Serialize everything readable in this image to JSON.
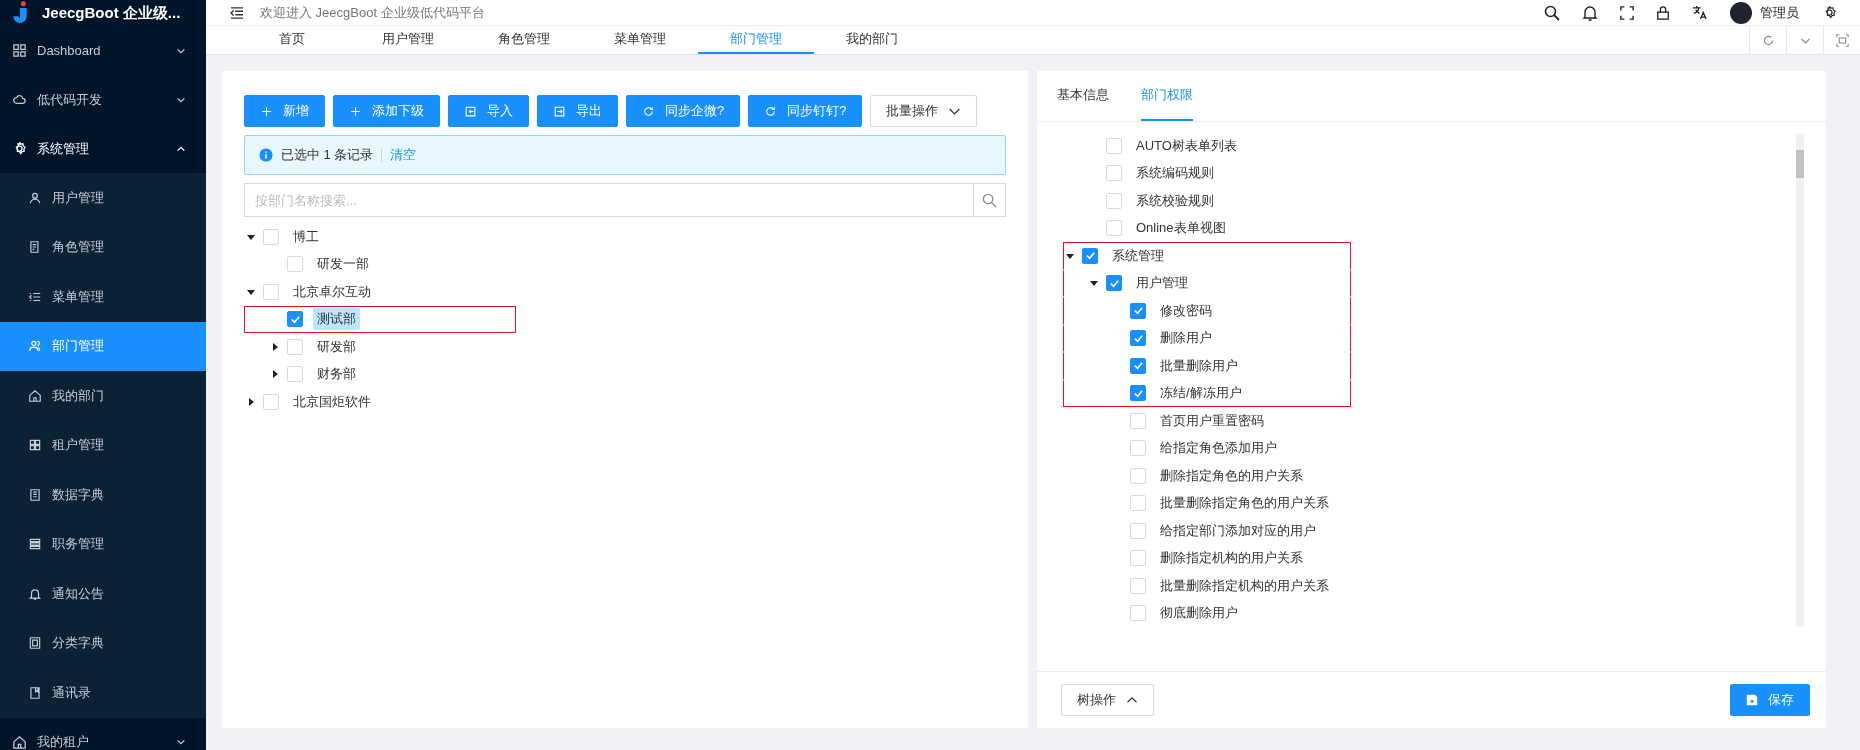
{
  "sidebar": {
    "logo_text": "JeecgBoot 企业级...",
    "items": [
      {
        "kind": "dashboard",
        "label": "Dashboard",
        "selected": false,
        "expanded": false
      },
      {
        "kind": "cloud",
        "label": "低代码开发",
        "selected": false,
        "expanded": false
      },
      {
        "kind": "gear",
        "label": "系统管理",
        "selected": false,
        "expanded": true,
        "children": [
          {
            "kind": "user",
            "label": "用户管理",
            "selected": false
          },
          {
            "kind": "role",
            "label": "角色管理",
            "selected": false
          },
          {
            "kind": "menu",
            "label": "菜单管理",
            "selected": false
          },
          {
            "kind": "team",
            "label": "部门管理",
            "selected": true
          },
          {
            "kind": "home",
            "label": "我的部门",
            "selected": false
          },
          {
            "kind": "grid",
            "label": "租户管理",
            "selected": false
          },
          {
            "kind": "book",
            "label": "数据字典",
            "selected": false
          },
          {
            "kind": "stack",
            "label": "职务管理",
            "selected": false
          },
          {
            "kind": "bell",
            "label": "通知公告",
            "selected": false
          },
          {
            "kind": "frame",
            "label": "分类字典",
            "selected": false
          },
          {
            "kind": "note",
            "label": "通讯录",
            "selected": false
          }
        ]
      },
      {
        "kind": "home",
        "label": "我的租户",
        "selected": false,
        "expanded": false
      }
    ]
  },
  "header": {
    "welcome": "欢迎进入 JeecgBoot 企业级低代码平台",
    "user_name": "管理员"
  },
  "tabs": [
    {
      "label": "首页",
      "selected": false
    },
    {
      "label": "用户管理",
      "selected": false
    },
    {
      "label": "角色管理",
      "selected": false
    },
    {
      "label": "菜单管理",
      "selected": false
    },
    {
      "label": "部门管理",
      "selected": true
    },
    {
      "label": "我的部门",
      "selected": false
    }
  ],
  "toolbar": [
    {
      "kind": "add",
      "label": "新增"
    },
    {
      "kind": "add",
      "label": "添加下级"
    },
    {
      "kind": "import",
      "label": "导入"
    },
    {
      "kind": "export",
      "label": "导出"
    },
    {
      "kind": "sync",
      "label": "同步企微?"
    },
    {
      "kind": "sync",
      "label": "同步钉钉?"
    },
    {
      "kind": "menu",
      "label": "批量操作"
    }
  ],
  "selection_alert": {
    "message": "已选中 1 条记录",
    "clear_link": "清空"
  },
  "dept_search": {
    "placeholder": "按部门名称搜索..."
  },
  "dept_tree": [
    {
      "kind": "branch",
      "label": "博工",
      "expanded": true,
      "checked": false,
      "selected": false,
      "highlighted": false,
      "children": [
        {
          "kind": "leaf",
          "label": "研发一部",
          "checked": false,
          "selected": false,
          "highlighted": false
        }
      ]
    },
    {
      "kind": "branch",
      "label": "北京卓尔互动",
      "expanded": true,
      "checked": false,
      "selected": false,
      "highlighted": false,
      "children": [
        {
          "kind": "leaf",
          "label": "测试部",
          "checked": true,
          "selected": true,
          "highlighted": true
        },
        {
          "kind": "branch",
          "label": "研发部",
          "expanded": false,
          "checked": false,
          "selected": false,
          "highlighted": false
        },
        {
          "kind": "branch",
          "label": "财务部",
          "expanded": false,
          "checked": false,
          "selected": false,
          "highlighted": false
        }
      ]
    },
    {
      "kind": "branch",
      "label": "北京国炬软件",
      "expanded": false,
      "checked": false,
      "selected": false,
      "highlighted": false
    }
  ],
  "detail_tabs": [
    {
      "label": "基本信息",
      "selected": false
    },
    {
      "label": "部门权限",
      "selected": true
    }
  ],
  "permission_tree": {
    "clipped_children": [
      {
        "kind": "leaf",
        "label": "AUTO树表单列表",
        "checked": false,
        "selected": false,
        "highlighted": false
      },
      {
        "kind": "leaf",
        "label": "系统编码规则",
        "checked": false,
        "selected": false,
        "highlighted": false
      },
      {
        "kind": "leaf",
        "label": "系统校验规则",
        "checked": false,
        "selected": false,
        "highlighted": false
      },
      {
        "kind": "leaf",
        "label": "Online表单视图",
        "checked": false,
        "selected": false,
        "highlighted": false
      }
    ],
    "nodes": [
      {
        "kind": "branch",
        "label": "系统管理",
        "expanded": true,
        "checked": true,
        "selected": false,
        "highlighted": true,
        "children": [
          {
            "kind": "branch",
            "label": "用户管理",
            "expanded": true,
            "checked": true,
            "selected": false,
            "highlighted": true,
            "children": [
              {
                "kind": "leaf",
                "label": "修改密码",
                "checked": true,
                "selected": false,
                "highlighted": true
              },
              {
                "kind": "leaf",
                "label": "删除用户",
                "checked": true,
                "selected": false,
                "highlighted": true
              },
              {
                "kind": "leaf",
                "label": "批量删除用户",
                "checked": true,
                "selected": false,
                "highlighted": true
              },
              {
                "kind": "leaf",
                "label": "冻结/解冻用户",
                "checked": true,
                "selected": false,
                "highlighted": true
              },
              {
                "kind": "leaf",
                "label": "首页用户重置密码",
                "checked": false,
                "selected": false,
                "highlighted": false
              },
              {
                "kind": "leaf",
                "label": "给指定角色添加用户",
                "checked": false,
                "selected": false,
                "highlighted": false
              },
              {
                "kind": "leaf",
                "label": "删除指定角色的用户关系",
                "checked": false,
                "selected": false,
                "highlighted": false
              },
              {
                "kind": "leaf",
                "label": "批量删除指定角色的用户关系",
                "checked": false,
                "selected": false,
                "highlighted": false
              },
              {
                "kind": "leaf",
                "label": "给指定部门添加对应的用户",
                "checked": false,
                "selected": false,
                "highlighted": false
              },
              {
                "kind": "leaf",
                "label": "删除指定机构的用户关系",
                "checked": false,
                "selected": false,
                "highlighted": false
              },
              {
                "kind": "leaf",
                "label": "批量删除指定机构的用户关系",
                "checked": false,
                "selected": false,
                "highlighted": false
              },
              {
                "kind": "leaf",
                "label": "彻底删除用户",
                "checked": false,
                "selected": false,
                "highlighted": false
              }
            ]
          }
        ]
      }
    ]
  },
  "footer": {
    "tree_menu_button": "树操作",
    "save_button": "保存"
  }
}
